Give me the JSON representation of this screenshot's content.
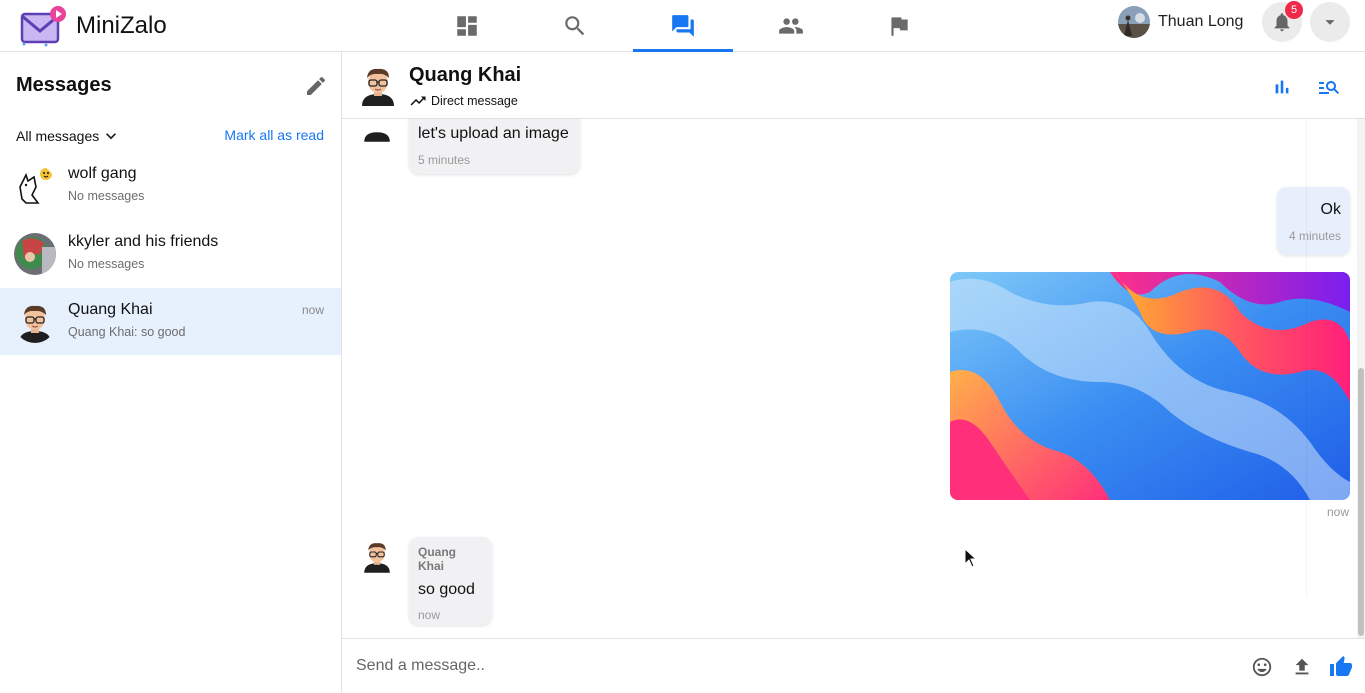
{
  "app": {
    "name": "MiniZalo"
  },
  "nav": {
    "tabs": [
      {
        "name": "dashboard",
        "icon": "dashboard-icon"
      },
      {
        "name": "search",
        "icon": "search-icon"
      },
      {
        "name": "messages",
        "icon": "forum-icon",
        "active": true
      },
      {
        "name": "friends",
        "icon": "people-icon"
      },
      {
        "name": "reports",
        "icon": "flag-icon"
      }
    ]
  },
  "user": {
    "name": "Thuan Long",
    "notifications": "5"
  },
  "sidebar": {
    "title": "Messages",
    "filter_label": "All messages",
    "mark_all_label": "Mark all as read",
    "conversations": [
      {
        "name": "wolf gang",
        "preview": "No messages",
        "time": ""
      },
      {
        "name": "kkyler and his friends",
        "preview": "No messages",
        "time": ""
      },
      {
        "name": "Quang Khai",
        "preview": "Quang Khai: so good",
        "time": "now",
        "active": true
      }
    ]
  },
  "chat": {
    "title": "Quang Khai",
    "type_label": "Direct message",
    "messages": [
      {
        "text": "let's upload an image",
        "time": "5 minutes",
        "mine": false
      },
      {
        "text": "Ok",
        "time": "4 minutes",
        "mine": true
      },
      {
        "image": true,
        "time": "now",
        "mine": true
      },
      {
        "sender": "Quang Khai",
        "text": "so good",
        "time": "now",
        "mine": false
      }
    ],
    "composer_placeholder": "Send a message.."
  },
  "colors": {
    "accent": "#1877f2",
    "active_bg": "#e7f0fd",
    "badge": "#f02849"
  }
}
